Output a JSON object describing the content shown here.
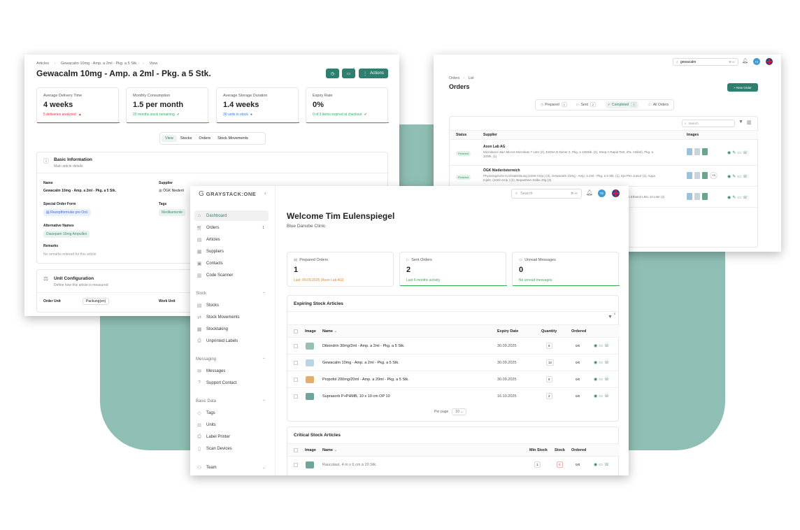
{
  "article_window": {
    "breadcrumb": [
      "Articles",
      "Gewacalm 10mg - Amp. a 2ml - Pkg. a 5 Stk.",
      "View"
    ],
    "title": "Gewacalm 10mg - Amp. a 2ml - Pkg. a 5 Stk.",
    "actions_label": "Actions",
    "badge_count": "0",
    "stats": [
      {
        "label": "Average Delivery Time",
        "value": "4 weeks",
        "sub": "5 deliveries analyzed",
        "color": "#d9393b"
      },
      {
        "label": "Monthly Consumption",
        "value": "1.5 per month",
        "sub": "20 months stock remaining",
        "color": "#3caa5a"
      },
      {
        "label": "Average Storage Duration",
        "value": "1.4 weeks",
        "sub": "30 units in stock",
        "color": "#3a74d6"
      },
      {
        "label": "Expiry Rate",
        "value": "0%",
        "sub": "0 of 3 items expired at checkout",
        "color": "#3caa5a"
      }
    ],
    "tabs": [
      "View",
      "Stocks",
      "Orders",
      "Stock Movements"
    ],
    "basic_info": {
      "title": "Basic Information",
      "subtitle": "Main article details",
      "name_label": "Name",
      "name_value": "Gewacalm 10mg - Amp. a 2ml - Pkg. a 5 Stk.",
      "supplier_label": "Supplier",
      "supplier_value": "ÖGK Niederö",
      "special_label": "Special Order Form",
      "special_value": "Rezeptformular pro Ord.",
      "tags_label": "Tags",
      "tags_value": "Medikamente",
      "alt_label": "Alternative Names",
      "alt_value": "Diazepam 10mg Ampullen",
      "remarks_label": "Remarks",
      "remarks_value": "No remarks entered for this article."
    },
    "unit_config": {
      "title": "Unit Configuration",
      "subtitle": "Define how this article is measured",
      "order_unit_label": "Order Unit",
      "order_unit_value": "Packung(en)",
      "work_unit_label": "Work Unit"
    }
  },
  "orders_window": {
    "search_value": "gewacalm",
    "search_shortcut": "⌘+K",
    "avatar": "TE",
    "breadcrumb": [
      "Orders",
      "List"
    ],
    "title": "Orders",
    "new_order_label": "+ New Order",
    "tabs": [
      {
        "label": "Prepared",
        "count": "1"
      },
      {
        "label": "Sent",
        "count": "2"
      },
      {
        "label": "Completed",
        "count": "3"
      },
      {
        "label": "All Orders",
        "count": ""
      }
    ],
    "search_placeholder": "Search",
    "columns": [
      "Status",
      "Supplier",
      "Images"
    ],
    "rows": [
      {
        "status": "Finished",
        "supplier": "Axon Lab AG",
        "detail": "Microlance 4&A Micros Microlean ? Liter (2), EXDIA D-Dimer 2, Pkg. a 100Stk. (2), Strep A Rapid Test, iPa. Artikel), Pkg. a 20Stk. (1)",
        "more": ""
      },
      {
        "status": "Finished",
        "supplier": "ÖGK Niederösterreich",
        "detail": "Physiologische Kochsalzlösung (10ml-Amp.) (3), Gewacalm 10mg - Amp. a 2ml - Pkg. a 5 Stk. (1), Epi Pen Junior (1), Aqua Injekt. (10ml-Amp.) (2), Bepanthen Salbe 20g (3)",
        "more": "+3"
      },
      {
        "status": "",
        "supplier": "",
        "detail": "ss Ethanol LB/u 10 Liter (2)",
        "more": ""
      }
    ]
  },
  "dashboard": {
    "logo_text": "GRAYSTACK:ONE",
    "search_placeholder": "Search",
    "search_shortcut": "⌘+K",
    "avatar": "TE",
    "sidebar_main": [
      {
        "label": "Dashboard",
        "count": ""
      },
      {
        "label": "Orders",
        "count": "1"
      },
      {
        "label": "Articles",
        "count": ""
      },
      {
        "label": "Suppliers",
        "count": ""
      },
      {
        "label": "Contacts",
        "count": ""
      },
      {
        "label": "Code Scanner",
        "count": ""
      }
    ],
    "section_stock": "Stock",
    "sidebar_stock": [
      "Stocks",
      "Stock Movements",
      "Stocktaking",
      "Unprinted Labels"
    ],
    "section_messaging": "Messaging",
    "sidebar_messaging": [
      "Messages",
      "Support Contact"
    ],
    "section_basic": "Basic Data",
    "sidebar_basic": [
      "Tags",
      "Units",
      "Label Printer",
      "Scan Devices"
    ],
    "section_team": "Team",
    "welcome": "Welcome Tim Eulenspiegel",
    "clinic": "Blue Danube Clinic",
    "stats": [
      {
        "label": "Prepared Orders",
        "value": "1",
        "sub": "Last: 09.09.2025 (Axon Lab AG)",
        "color": "#d98a2b"
      },
      {
        "label": "Sent Orders",
        "value": "2",
        "sub": "Last 6 months activity",
        "color": "#3caa5a"
      },
      {
        "label": "Unread Messages",
        "value": "0",
        "sub": "No unread messages",
        "color": "#3caa5a"
      }
    ],
    "expiring": {
      "title": "Expiring Stock Articles",
      "columns": [
        "Image",
        "Name",
        "Expiry Date",
        "Quantity",
        "Ordered"
      ],
      "rows": [
        {
          "name": "Dibondrin 30mg/2ml - Amp. a 2ml - Pkg. a 5 Stk.",
          "date": "30.09.2025",
          "qty": "6",
          "ordered": "0/0"
        },
        {
          "name": "Gewacalm 10mg - Amp. a 2ml - Pkg. a 5 Stk.",
          "date": "30.09.2025",
          "qty": "12",
          "ordered": "0/0"
        },
        {
          "name": "Propofol 200mg/20ml - Amp. a 20ml - Pkg. a 5 Stk.",
          "date": "30.09.2025",
          "qty": "5",
          "ordered": "0/0"
        },
        {
          "name": "Suprasorb P+PHMB, 10 x 10 cm OP 10",
          "date": "16.10.2025",
          "qty": "2",
          "ordered": "0/0"
        }
      ],
      "per_page_label": "Per page",
      "per_page_value": "10"
    },
    "critical": {
      "title": "Critical Stock Articles",
      "columns": [
        "Image",
        "Name",
        "Min Stock",
        "Stock",
        "Ordered"
      ],
      "rows": [
        {
          "name": "Raucolast, 4 m x 6 cm à 20 Stk.",
          "min": "1",
          "stock": "0",
          "ordered": "0/0"
        }
      ]
    }
  },
  "colors": {
    "accent": "#2f7f6f",
    "background_shape": "#8fbfb4"
  }
}
